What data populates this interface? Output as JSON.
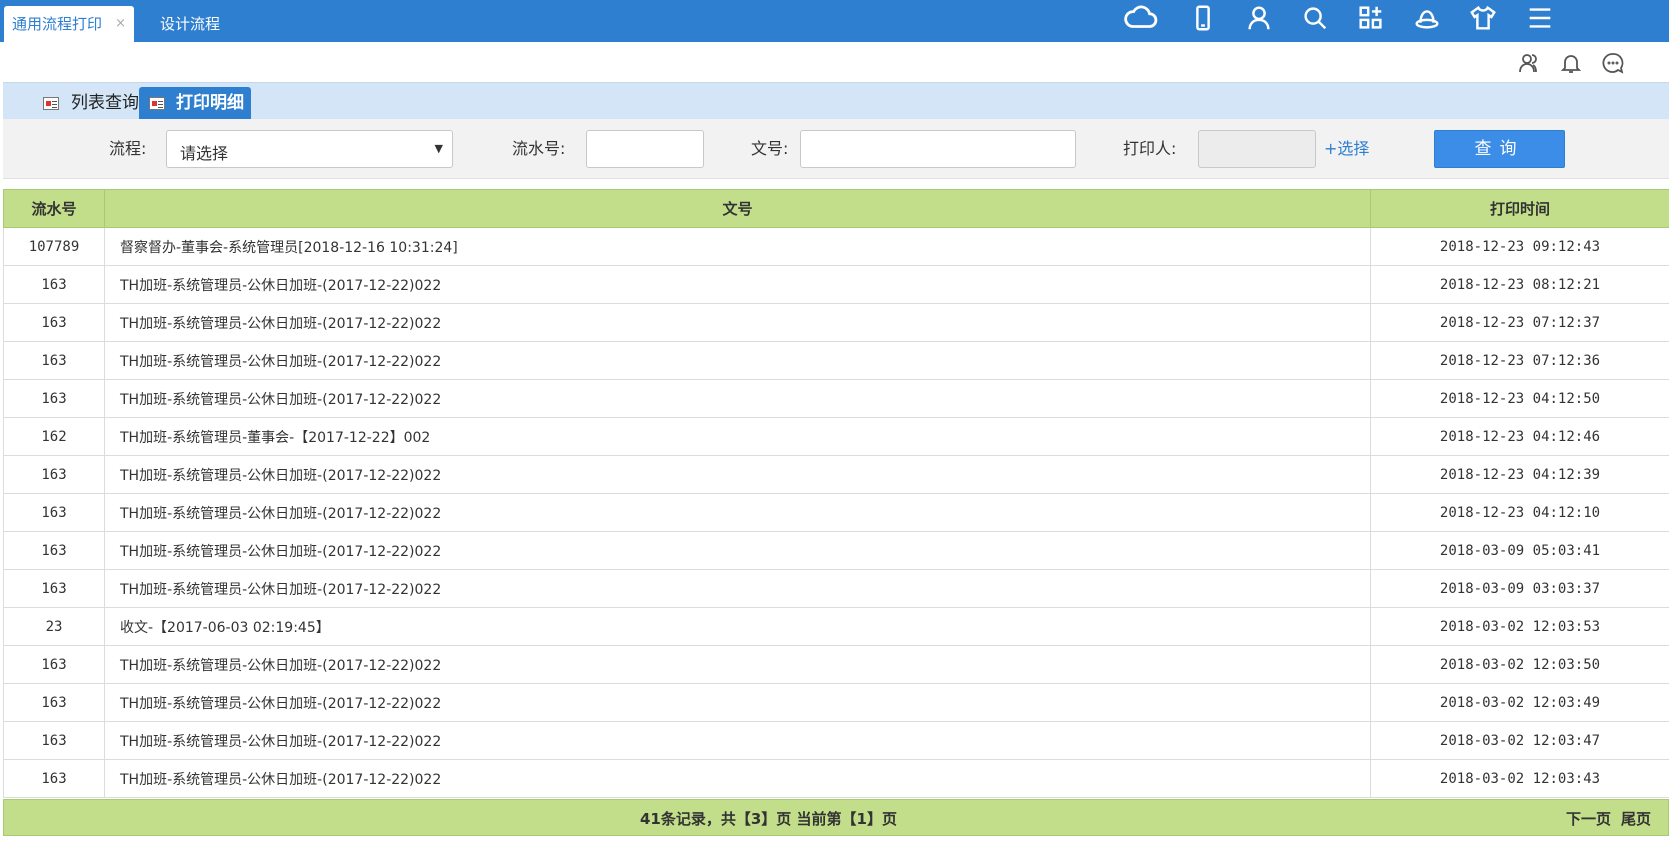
{
  "tabs": {
    "active_label": "通用流程打印",
    "close_glyph": "×",
    "inactive_label": "设计流程"
  },
  "top_icons": [
    "cloud-icon",
    "mobile-icon",
    "user-icon",
    "search-icon",
    "apps-icon",
    "hat-icon",
    "shirt-icon",
    "menu-icon"
  ],
  "sub_icons": [
    "contacts-icon",
    "bell-icon",
    "chat-icon"
  ],
  "subtabs": {
    "list_query": "列表查询",
    "print_detail": "打印明细"
  },
  "filters": {
    "flow_label": "流程:",
    "flow_value": "请选择",
    "serial_label": "流水号:",
    "serial_value": "",
    "doc_label": "文号:",
    "doc_value": "",
    "printer_label": "打印人:",
    "printer_value": "",
    "choose_label": "+选择",
    "query_button": "查询"
  },
  "table": {
    "headers": [
      "流水号",
      "文号",
      "打印时间"
    ],
    "rows": [
      [
        "107789",
        "督察督办-董事会-系统管理员[2018-12-16 10:31:24]",
        "2018-12-23 09:12:43"
      ],
      [
        "163",
        "TH加班-系统管理员-公休日加班-(2017-12-22)022",
        "2018-12-23 08:12:21"
      ],
      [
        "163",
        "TH加班-系统管理员-公休日加班-(2017-12-22)022",
        "2018-12-23 07:12:37"
      ],
      [
        "163",
        "TH加班-系统管理员-公休日加班-(2017-12-22)022",
        "2018-12-23 07:12:36"
      ],
      [
        "163",
        "TH加班-系统管理员-公休日加班-(2017-12-22)022",
        "2018-12-23 04:12:50"
      ],
      [
        "162",
        "TH加班-系统管理员-董事会-【2017-12-22】002",
        "2018-12-23 04:12:46"
      ],
      [
        "163",
        "TH加班-系统管理员-公休日加班-(2017-12-22)022",
        "2018-12-23 04:12:39"
      ],
      [
        "163",
        "TH加班-系统管理员-公休日加班-(2017-12-22)022",
        "2018-12-23 04:12:10"
      ],
      [
        "163",
        "TH加班-系统管理员-公休日加班-(2017-12-22)022",
        "2018-03-09 05:03:41"
      ],
      [
        "163",
        "TH加班-系统管理员-公休日加班-(2017-12-22)022",
        "2018-03-09 03:03:37"
      ],
      [
        "23",
        "收文-【2017-06-03 02:19:45】",
        "2018-03-02 12:03:53"
      ],
      [
        "163",
        "TH加班-系统管理员-公休日加班-(2017-12-22)022",
        "2018-03-02 12:03:50"
      ],
      [
        "163",
        "TH加班-系统管理员-公休日加班-(2017-12-22)022",
        "2018-03-02 12:03:49"
      ],
      [
        "163",
        "TH加班-系统管理员-公休日加班-(2017-12-22)022",
        "2018-03-02 12:03:47"
      ],
      [
        "163",
        "TH加班-系统管理员-公休日加班-(2017-12-22)022",
        "2018-03-02 12:03:43"
      ]
    ]
  },
  "pager": {
    "info": "41条记录，共【3】页 当前第【1】页",
    "next": "下一页",
    "last": "尾页"
  }
}
